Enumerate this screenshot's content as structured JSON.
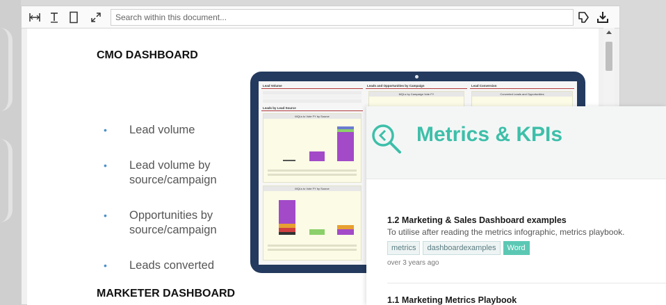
{
  "toolbar": {
    "search_placeholder": "Search within this document...",
    "icons": [
      "fit-width-icon",
      "text-select-icon",
      "single-page-icon",
      "fullscreen-icon",
      "pin-icon",
      "download-icon"
    ]
  },
  "document": {
    "heading_1": "CMO DASHBOARD",
    "bullets": [
      {
        "line1": "Lead volume",
        "line2": ""
      },
      {
        "line1": "Lead volume by",
        "line2": "source/campaign"
      },
      {
        "line1": "Opportunities  by",
        "line2": "source/campaign"
      },
      {
        "line1": "Leads converted",
        "line2": ""
      }
    ],
    "heading_2": "MARKETER DASHBOARD",
    "illustration": {
      "panels": [
        "Lead Volume",
        "Leads and Opportunities by Campaign",
        "Lead Conversion",
        "Leads by Lead Source"
      ],
      "chart_titles": [
        "MQLs to Vote FY by Source",
        "MQLs to Vote FY by Source"
      ],
      "x_labels_top": [
        "April 2018",
        "May 2018",
        "June 2018"
      ],
      "x_labels_bottom": [
        "April 2018",
        "May 2018",
        "June 2018"
      ],
      "campaign_chart_title": "MQLs by Campaign Vote FY",
      "conversion_chart_title": "Converted Leads and Opportunities"
    }
  },
  "kpi_card": {
    "title": "Metrics & KPIs",
    "accent": "#3dbfa9",
    "resources": [
      {
        "title": "1.2 Marketing & Sales Dashboard examples",
        "description": "To utilise after reading the metrics infographic, metrics playbook.",
        "tags": [
          "metrics",
          "dashboardexamples",
          "Word"
        ],
        "time": "over 3 years ago"
      },
      {
        "title": "1.1 Marketing Metrics Playbook"
      }
    ]
  }
}
